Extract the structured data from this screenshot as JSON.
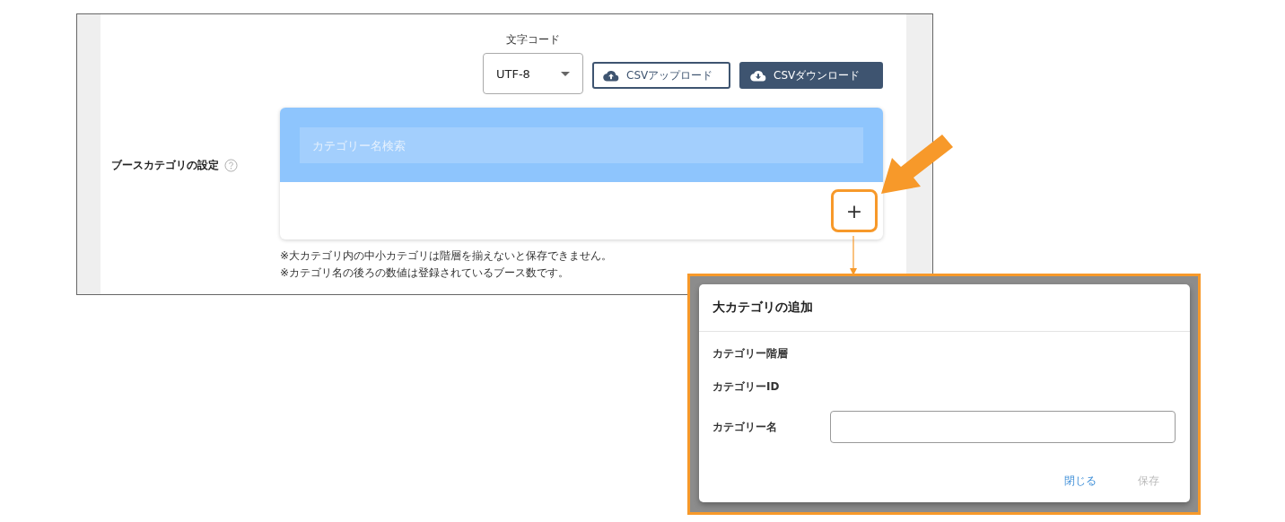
{
  "encoding": {
    "label": "文字コード",
    "value": "UTF-8"
  },
  "csv_buttons": [
    {
      "label": "CSVアップロード",
      "kind": "upload"
    },
    {
      "label": "CSVダウンロード",
      "kind": "download"
    }
  ],
  "booth_category": {
    "label": "ブースカテゴリの設定",
    "search": {
      "placeholder": "カテゴリー名検索"
    },
    "add_symbol": "+",
    "notes": [
      "※大カテゴリ内の中小カテゴリは階層を揃えないと保存できません。",
      "※カテゴリ名の後ろの数値は登録されているブース数です。"
    ]
  },
  "dialog": {
    "title": "大カテゴリの追加",
    "fields": [
      {
        "label": "カテゴリー階層",
        "kind": "text"
      },
      {
        "label": "カテゴリーID",
        "kind": "text"
      },
      {
        "label": "カテゴリー名",
        "kind": "input"
      }
    ],
    "actions": [
      {
        "label": "閉じる",
        "disabled": false
      },
      {
        "label": "保存",
        "disabled": true
      }
    ]
  }
}
